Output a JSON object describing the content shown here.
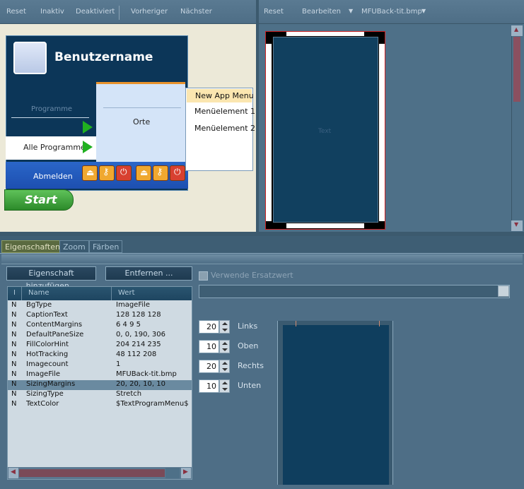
{
  "left_toolbar": {
    "reset": "Reset",
    "inaktiv": "Inaktiv",
    "deaktiviert": "Deaktiviert",
    "vorheriger": "Vorheriger",
    "naechster": "Nächster"
  },
  "right_toolbar": {
    "reset": "Reset",
    "bearbeiten": "Bearbeiten",
    "file": "MFUBack-tit.bmp"
  },
  "startmenu": {
    "username": "Benutzername",
    "programme": "Programme",
    "alle_programme": "Alle Programme",
    "orte": "Orte",
    "abmelden": "Abmelden",
    "start": "Start",
    "submenu": [
      "New App Menu",
      "Menüelement 1",
      "Menüelement 2"
    ]
  },
  "preview": {
    "text": "Text"
  },
  "tabs": [
    "Eigenschaften",
    "Zoom",
    "Färben"
  ],
  "buttons": {
    "add": "Eigenschaft hinzufügen...",
    "remove": "Entfernen ..."
  },
  "grid": {
    "columns": [
      "I",
      "Name",
      "Wert"
    ],
    "rows": [
      [
        "N",
        "BgType",
        "ImageFile"
      ],
      [
        "N",
        "CaptionText",
        "128 128 128"
      ],
      [
        "N",
        "ContentMargins",
        "6 4 9 5"
      ],
      [
        "N",
        "DefaultPaneSize",
        "0, 0, 190, 306"
      ],
      [
        "N",
        "FillColorHint",
        "204 214 235"
      ],
      [
        "N",
        "HotTracking",
        "48 112 208"
      ],
      [
        "N",
        "Imagecount",
        "1"
      ],
      [
        "N",
        "ImageFile",
        "MFUBack-tit.bmp"
      ],
      [
        "N",
        "SizingMargins",
        "20, 20, 10, 10"
      ],
      [
        "N",
        "SizingType",
        "Stretch"
      ],
      [
        "N",
        "TextColor",
        "$TextProgramMenu$"
      ]
    ],
    "selected_row": 8
  },
  "ersatz": {
    "label": "Verwende Ersatzwert"
  },
  "margins": [
    {
      "value": "20",
      "label": "Links"
    },
    {
      "value": "10",
      "label": "Oben"
    },
    {
      "value": "20",
      "label": "Rechts"
    },
    {
      "value": "10",
      "label": "Unten"
    }
  ]
}
